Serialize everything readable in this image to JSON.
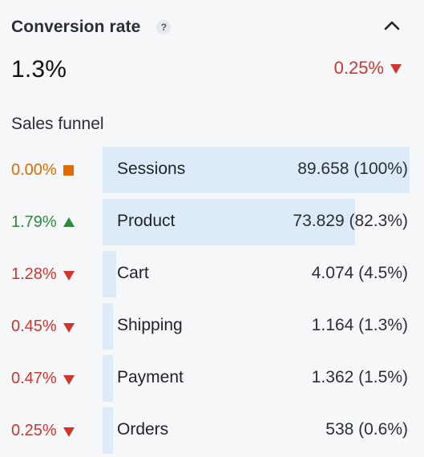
{
  "header": {
    "title": "Conversion rate",
    "help_label": "?"
  },
  "summary": {
    "value": "1.3%",
    "delta": "0.25%",
    "delta_direction": "down"
  },
  "section": {
    "title": "Sales funnel"
  },
  "colors": {
    "background": "#f6f7f9",
    "bar": "#dcebf7",
    "up": "#2f8a3f",
    "down": "#d0362f",
    "neutral": "#e06c00"
  },
  "funnel": {
    "rows": [
      {
        "rate": "0.00%",
        "indicator": "square-icon",
        "label": "Sessions",
        "value": "89.658 (100%)",
        "share": 1.0
      },
      {
        "rate": "1.79%",
        "indicator": "triangle-up-icon",
        "label": "Product",
        "value": "73.829 (82.3%)",
        "share": 0.823
      },
      {
        "rate": "1.28%",
        "indicator": "triangle-down-icon",
        "label": "Cart",
        "value": "4.074 (4.5%)",
        "share": 0.045
      },
      {
        "rate": "0.45%",
        "indicator": "triangle-down-icon",
        "label": "Shipping",
        "value": "1.164 (1.3%)",
        "share": 0.013
      },
      {
        "rate": "0.47%",
        "indicator": "triangle-down-icon",
        "label": "Payment",
        "value": "1.362 (1.5%)",
        "share": 0.015
      },
      {
        "rate": "0.25%",
        "indicator": "triangle-down-icon",
        "label": "Orders",
        "value": "538 (0.6%)",
        "share": 0.006
      }
    ]
  }
}
